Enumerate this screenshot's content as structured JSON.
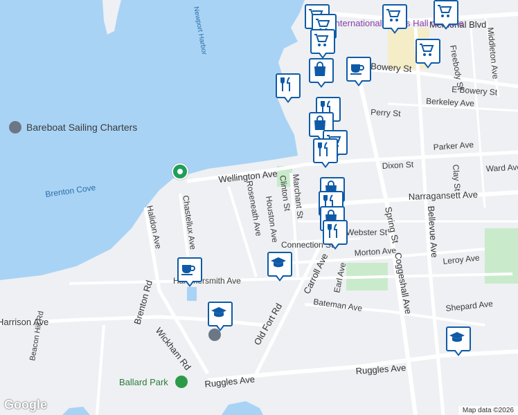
{
  "map": {
    "colors": {
      "water": "#a9d3f5",
      "land": "#eef0f3",
      "road": "#ffffff",
      "park": "#c9ebcb",
      "marker_border": "#0e5aa7",
      "marker_icon": "#0e5aa7",
      "poi_green": "#1e9e5a"
    },
    "labels": {
      "memorial_blvd": "Memorial Blvd",
      "hall_of_fame": "International Tennis Hall of Fame",
      "bowery_st": "Bowery St",
      "e_bowery_st": "E Bowery St",
      "berkeley_ave": "Berkeley Ave",
      "perry_st": "Perry St",
      "parker_ave": "Parker Ave",
      "dixon_st": "Dixon St",
      "ward_ave": "Ward Ave",
      "wellington_ave": "Wellington Ave",
      "narragansett_ave": "Narragansett Ave",
      "brenton_cove": "Brenton Cove",
      "bareboat": "Bareboat Sailing Charters",
      "newport_harbor": "Newport Harbor",
      "chastellux_ave": "Chastellux Ave",
      "halidon_ave": "Halidon Ave",
      "roseneath_ave": "Roseneath Ave",
      "houston_ave": "Houston Ave",
      "clinton_st": "Clinton St",
      "marchant_st": "Marchant St",
      "spring_st": "Spring St",
      "coggeshall_ave": "Coggeshall Ave",
      "bellevue_ave": "Bellevue Ave",
      "freebody_st": "Freebody St",
      "middleton_ave": "Middleton Ave",
      "clay_st": "Clay St",
      "morton_ave": "Morton Ave",
      "leroy_ave": "Leroy Ave",
      "connection_st": "Connection St",
      "carroll_ave": "Carroll Ave",
      "earl_ave": "Earl Ave",
      "webster_st": "Webster St",
      "harrison_ave": "Harrison Ave",
      "beacon_hill_rd": "Beacon Hill Rd",
      "brenton_rd": "Brenton Rd",
      "wickham_rd": "Wickham Rd",
      "old_fort_rd": "Old Fort Rd",
      "bateman_ave": "Bateman Ave",
      "shepard_ave": "Shepard Ave",
      "ruggles_ave": "Ruggles Ave",
      "ballard_park": "Ballard Park",
      "hammersmith_ave": "Hammersmith Ave"
    },
    "markers": [
      {
        "type": "cart",
        "icon": "shopping-cart-icon"
      },
      {
        "type": "cart",
        "icon": "shopping-cart-icon"
      },
      {
        "type": "cart",
        "icon": "shopping-cart-icon"
      },
      {
        "type": "cart",
        "icon": "shopping-cart-icon"
      },
      {
        "type": "cart",
        "icon": "shopping-cart-icon"
      },
      {
        "type": "cart",
        "icon": "shopping-cart-icon"
      },
      {
        "type": "coffee",
        "icon": "coffee-cup-icon"
      },
      {
        "type": "restaurant",
        "icon": "fork-knife-icon"
      },
      {
        "type": "bag",
        "icon": "shopping-bag-icon"
      },
      {
        "type": "restaurant",
        "icon": "fork-knife-icon"
      },
      {
        "type": "bag",
        "icon": "shopping-bag-icon"
      },
      {
        "type": "cart",
        "icon": "shopping-cart-icon"
      },
      {
        "type": "restaurant",
        "icon": "fork-knife-icon"
      },
      {
        "type": "bag",
        "icon": "shopping-bag-icon"
      },
      {
        "type": "restaurant",
        "icon": "fork-knife-icon"
      },
      {
        "type": "bag",
        "icon": "shopping-bag-icon"
      },
      {
        "type": "restaurant",
        "icon": "fork-knife-icon"
      },
      {
        "type": "school",
        "icon": "graduation-cap-icon"
      },
      {
        "type": "coffee",
        "icon": "coffee-cup-icon"
      },
      {
        "type": "school",
        "icon": "graduation-cap-icon"
      },
      {
        "type": "school",
        "icon": "graduation-cap-icon"
      }
    ],
    "attribution": "Map data ©2026",
    "logo": "Google"
  }
}
